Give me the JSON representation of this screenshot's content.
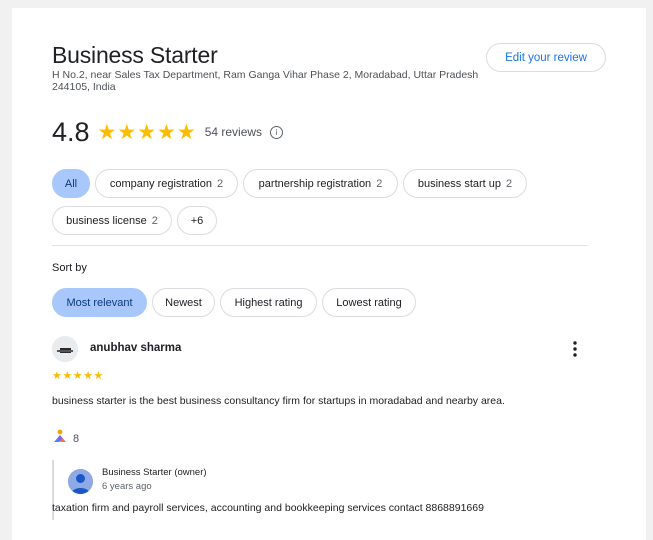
{
  "business": {
    "name": "Business Starter",
    "address": "H No.2, near Sales Tax Department, Ram Ganga Vihar Phase 2, Moradabad, Uttar Pradesh 244105, India",
    "edit_review_label": "Edit your review"
  },
  "rating": {
    "value": "4.8",
    "stars": "★★★★★",
    "count_label": "54 reviews",
    "info_icon": "info-icon"
  },
  "topics": {
    "all_label": "All",
    "chips": [
      {
        "label": "company registration",
        "count": "2"
      },
      {
        "label": "partnership registration",
        "count": "2"
      },
      {
        "label": "business start up",
        "count": "2"
      },
      {
        "label": "business license",
        "count": "2"
      }
    ],
    "more_label": "+6"
  },
  "sort": {
    "label": "Sort by",
    "options": [
      "Most relevant",
      "Newest",
      "Highest rating",
      "Lowest rating"
    ],
    "selected": "Most relevant"
  },
  "review": {
    "author": "anubhav sharma",
    "stars": "★★★★★",
    "text": "business starter is the best business consultancy firm for startups in moradabad and nearby area.",
    "like_count": "8",
    "more_icon": "more-vert-icon",
    "reply": {
      "author": "Business Starter (owner)",
      "time": "6 years ago",
      "text": "taxation firm and payroll services, accounting and bookkeeping services contact 8868891669"
    }
  },
  "colors": {
    "accent": "#1a73e8",
    "selected_chip": "#a8c7fa",
    "star": "#fbbc04"
  }
}
